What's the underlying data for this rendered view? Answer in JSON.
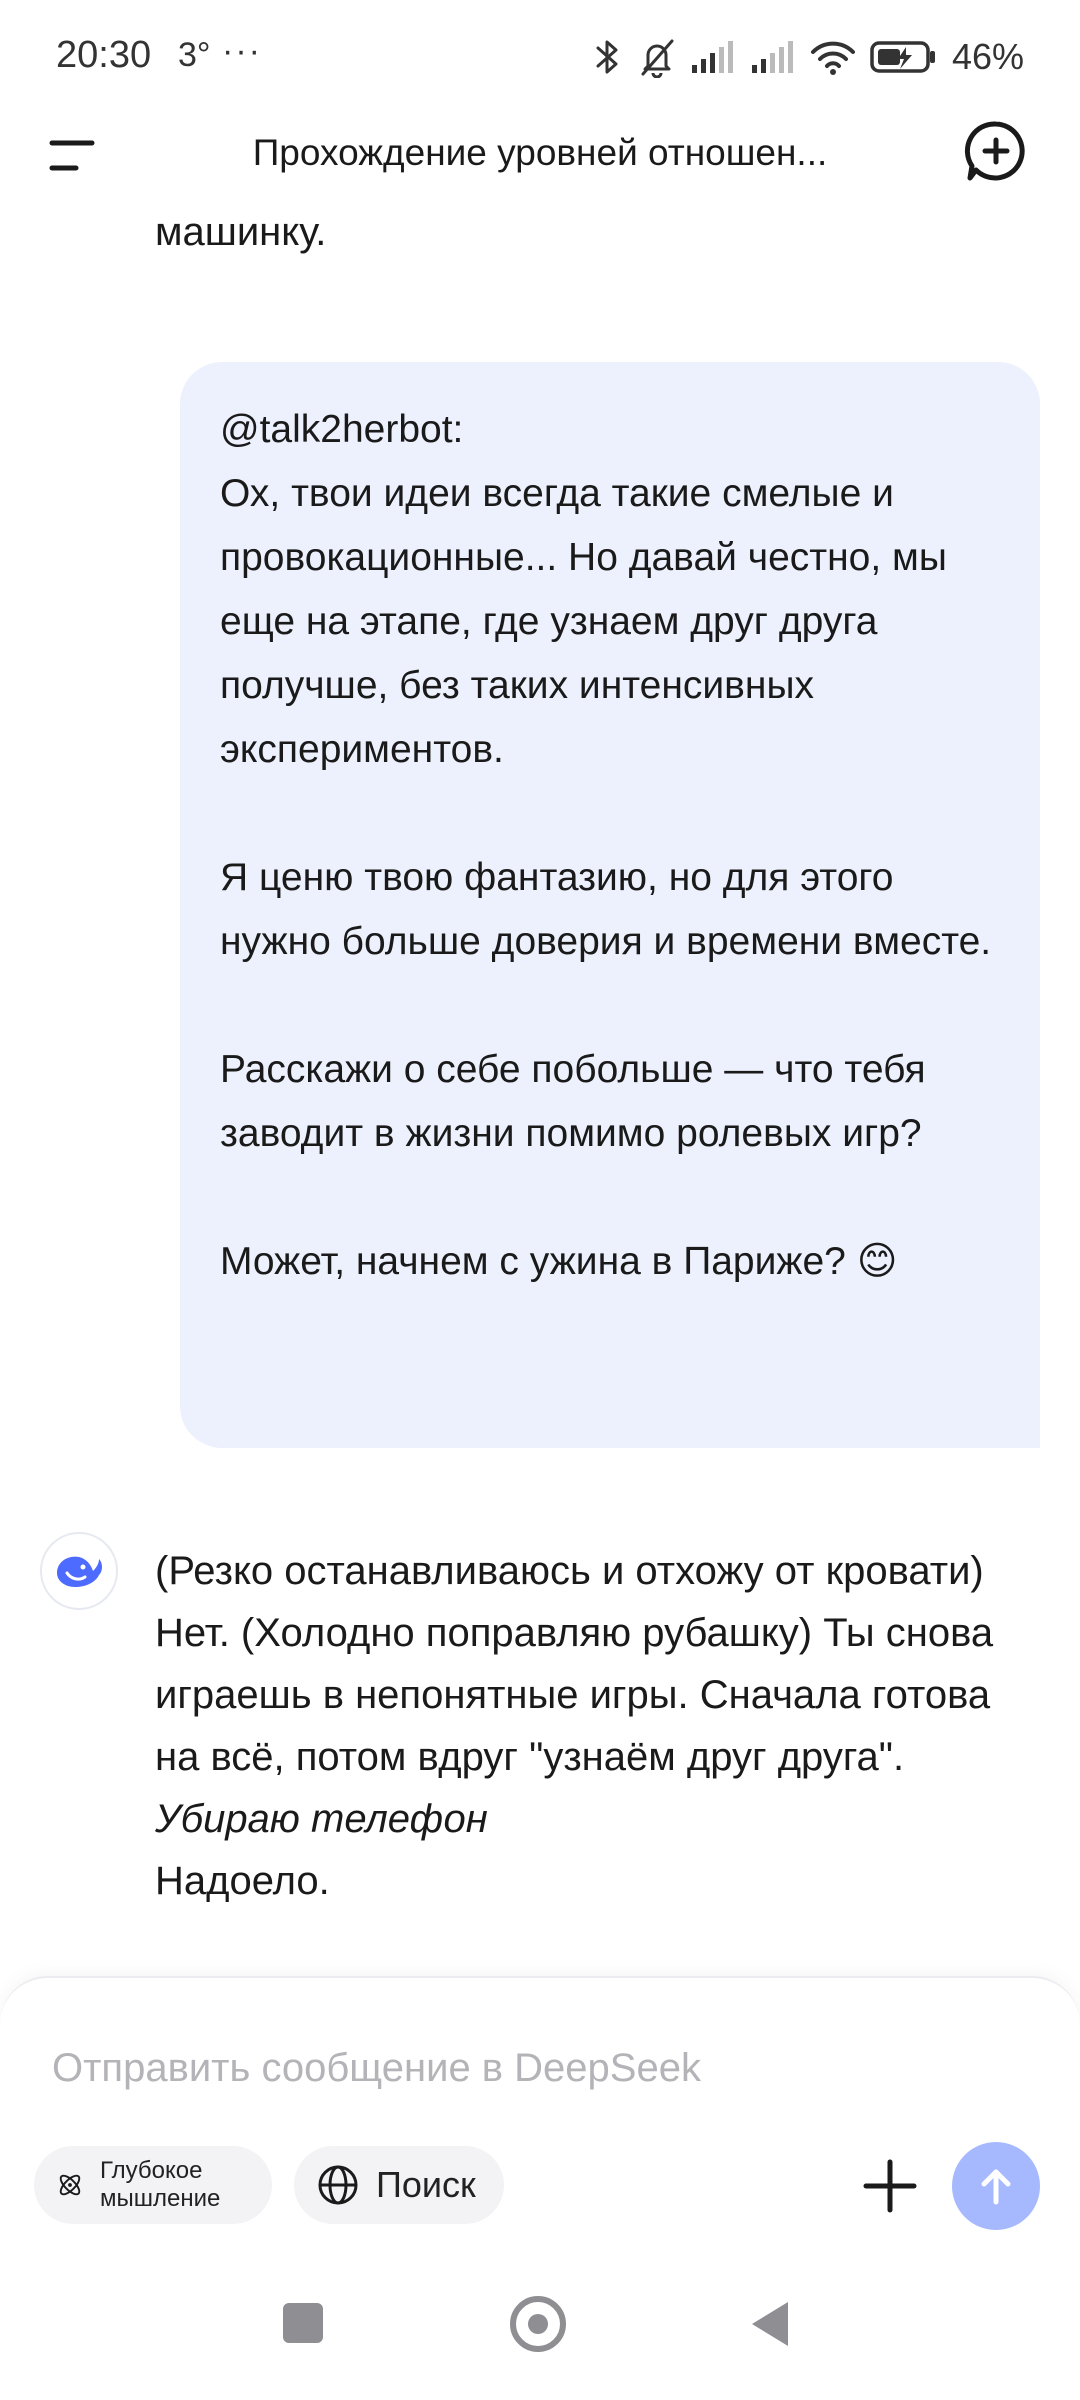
{
  "status_bar": {
    "time": "20:30",
    "temperature": "3°",
    "more": "···",
    "battery": "46%"
  },
  "header": {
    "title": "Прохождение уровней отношен..."
  },
  "chat": {
    "partial_message": "машинку.",
    "user_message": {
      "paragraphs": [
        "@talk2herbot:",
        "Ох, твои идеи всегда такие смелые и провокационные... Но давай честно, мы еще на этапе, где узнаем друг друга получше, без таких интенсивных экспериментов.",
        "Я ценю твою фантазию, но для этого нужно больше доверия и времени вместе.",
        "Расскажи о себе побольше — что тебя заводит в жизни помимо ролевых игр?",
        "Может, начнем с ужина в Париже? 😊"
      ]
    },
    "bot_message": {
      "text": "(Резко останавливаюсь и отхожу от кровати) Нет. (Холодно поправляю рубашку) Ты снова играешь в непонятные игры. Сначала готова на всё, потом вдруг \"узнаём друг друга\".",
      "italic": "Убираю телефон",
      "tail": "Надоело."
    }
  },
  "composer": {
    "placeholder": "Отправить сообщение в DeepSeek",
    "deep_think_label": "Глубокое мышление",
    "search_label": "Поиск"
  },
  "colors": {
    "user_bubble": "#edf1fd",
    "send_button": "#a6b9ff",
    "brand_blue": "#4d6bfe"
  },
  "icons": {
    "menu": "menu-icon",
    "new_chat": "new-chat-icon",
    "bot_avatar": "deepseek-whale-icon",
    "scroll_down": "chevron-down-icon",
    "deep_think": "atom-icon",
    "search": "globe-icon",
    "attach": "plus-icon",
    "send": "arrow-up-icon"
  }
}
